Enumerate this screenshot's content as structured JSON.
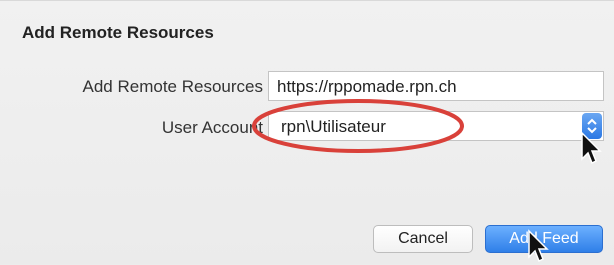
{
  "dialog": {
    "title": "Add Remote Resources"
  },
  "form": {
    "url_label": "Add Remote Resources",
    "url_value": "https://rppomade.rpn.ch",
    "account_label": "User Account",
    "account_value": "rpn\\Utilisateur"
  },
  "buttons": {
    "cancel_label": "Cancel",
    "add_label": "Add Feed"
  },
  "colors": {
    "accent": "#2f7fe8",
    "highlight_ellipse": "#d9413a"
  },
  "icons": {
    "select_stepper": "updown-chevron-icon",
    "cursor": "arrow-cursor-icon"
  }
}
